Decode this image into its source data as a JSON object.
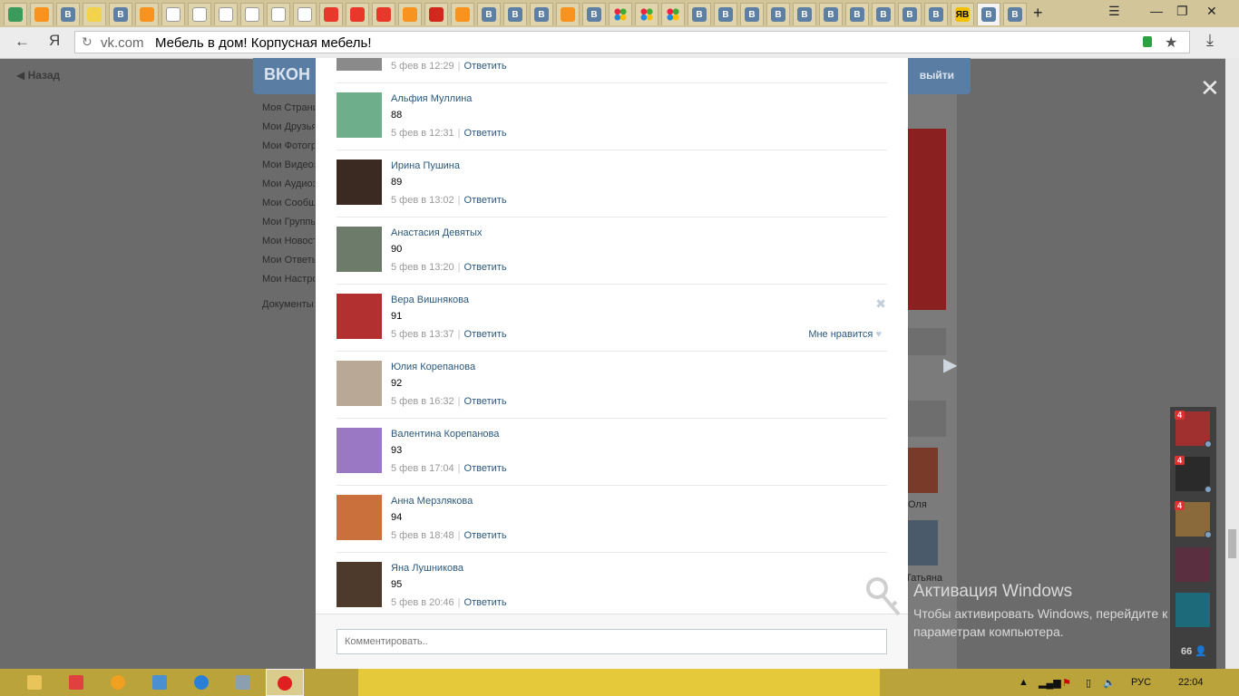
{
  "browser": {
    "tabs": [
      {
        "icon": "green"
      },
      {
        "icon": "ok"
      },
      {
        "icon": "vk",
        "glyph": "В"
      },
      {
        "icon": "search"
      },
      {
        "icon": "vk",
        "glyph": "В"
      },
      {
        "icon": "ok"
      },
      {
        "icon": "doc"
      },
      {
        "icon": "doc"
      },
      {
        "icon": "doc"
      },
      {
        "icon": "doc"
      },
      {
        "icon": "doc"
      },
      {
        "icon": "doc"
      },
      {
        "icon": "ya"
      },
      {
        "icon": "ya"
      },
      {
        "icon": "ya"
      },
      {
        "icon": "ok"
      },
      {
        "icon": "shop"
      },
      {
        "icon": "ok"
      },
      {
        "icon": "vk",
        "glyph": "В"
      },
      {
        "icon": "vk",
        "glyph": "В"
      },
      {
        "icon": "vk",
        "glyph": "В"
      },
      {
        "icon": "ok"
      },
      {
        "icon": "vk",
        "glyph": "В"
      },
      {
        "icon": "dots"
      },
      {
        "icon": "dots"
      },
      {
        "icon": "dots"
      },
      {
        "icon": "vk",
        "glyph": "В"
      },
      {
        "icon": "vk",
        "glyph": "В"
      },
      {
        "icon": "vk",
        "glyph": "В"
      },
      {
        "icon": "vk",
        "glyph": "В"
      },
      {
        "icon": "vk",
        "glyph": "В"
      },
      {
        "icon": "vk",
        "glyph": "В"
      },
      {
        "icon": "vk",
        "glyph": "В"
      },
      {
        "icon": "vk",
        "glyph": "В"
      },
      {
        "icon": "vk",
        "glyph": "В"
      },
      {
        "icon": "vk",
        "glyph": "В"
      },
      {
        "icon": "yellow",
        "glyph": "ЯВ"
      },
      {
        "icon": "vk",
        "glyph": "В",
        "active": true
      },
      {
        "icon": "vk",
        "glyph": "В"
      }
    ],
    "new_tab": "+",
    "domain": "vk.com",
    "page_title": "Мебель в дом! Корпусная мебель!",
    "yandex_letter": "Я"
  },
  "backdrop": {
    "back_label": "Назад",
    "vk_logo": "ВКОН",
    "exit_label": "выйти",
    "menu": [
      "Моя Страница",
      "Мои Друзья",
      "Мои Фотографии",
      "Мои Видеозаписи",
      "Мои Аудиозаписи",
      "Мои Сообщения",
      "Мои Группы",
      "Мои Новости",
      "Мои Ответы",
      "Мои Настройки"
    ],
    "documents": "Документы",
    "friend_names": [
      "Оля",
      "Татьяна"
    ]
  },
  "comments": [
    {
      "name": "",
      "text": "",
      "date": "5 фев в 12:29",
      "reply": "Ответить",
      "avatar": "#8a8a8a"
    },
    {
      "name": "Альфия Муллина",
      "text": "88",
      "date": "5 фев в 12:31",
      "reply": "Ответить",
      "avatar": "#6fae8b"
    },
    {
      "name": "Ирина Пушина",
      "text": "89",
      "date": "5 фев в 13:02",
      "reply": "Ответить",
      "avatar": "#3a2a22"
    },
    {
      "name": "Анастасия Девятых",
      "text": "90",
      "date": "5 фев в 13:20",
      "reply": "Ответить",
      "avatar": "#6d7b6a"
    },
    {
      "name": "Вера Вишнякова",
      "text": "91",
      "date": "5 фев в 13:37",
      "reply": "Ответить",
      "avatar": "#b23030",
      "like": "Мне нравится",
      "hover": true
    },
    {
      "name": "Юлия Корепанова",
      "text": "92",
      "date": "5 фев в 16:32",
      "reply": "Ответить",
      "avatar": "#b9a896"
    },
    {
      "name": "Валентина Корепанова",
      "text": "93",
      "date": "5 фев в 17:04",
      "reply": "Ответить",
      "avatar": "#9a78c4"
    },
    {
      "name": "Анна Мерзлякова",
      "text": "94",
      "date": "5 фев в 18:48",
      "reply": "Ответить",
      "avatar": "#c9703d"
    },
    {
      "name": "Яна Лушникова",
      "text": "95",
      "date": "5 фев в 20:46",
      "reply": "Ответить",
      "avatar": "#4d3a2c"
    }
  ],
  "comment_input": {
    "placeholder": "Комментировать.."
  },
  "chat": {
    "contacts": [
      {
        "badge": "4",
        "online": true,
        "color": "#a03030"
      },
      {
        "badge": "4",
        "online": true,
        "color": "#2a2a2a"
      },
      {
        "badge": "4",
        "online": true,
        "color": "#8a6a3a"
      },
      {
        "badge": "",
        "online": false,
        "color": "#5a3040"
      },
      {
        "badge": "",
        "online": false,
        "color": "#1d6a7a"
      }
    ],
    "online_count": "66"
  },
  "watermark": {
    "title": "Активация Windows",
    "text": "Чтобы активировать Windows, перейдите к\nпараметрам компьютера."
  },
  "taskbar": {
    "language": "РУС",
    "time": "22:04"
  }
}
